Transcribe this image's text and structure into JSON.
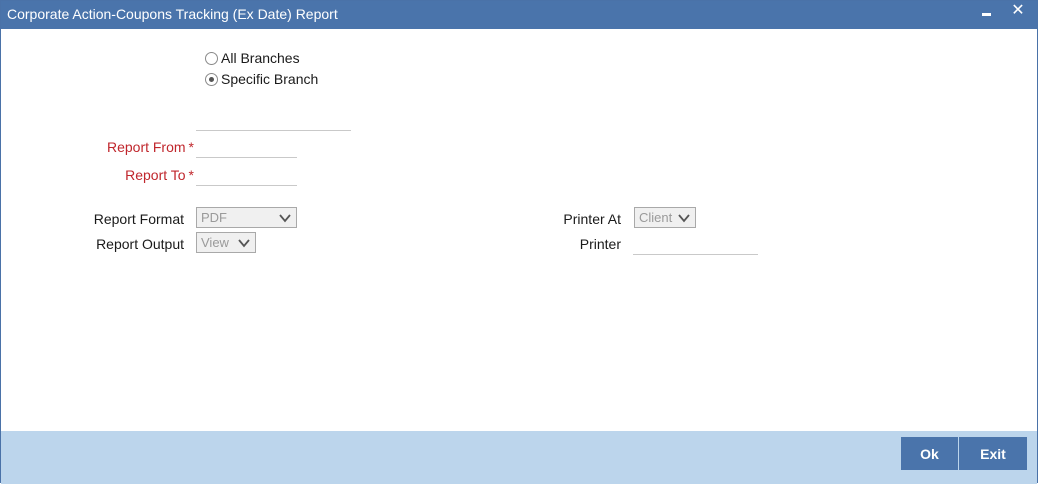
{
  "window": {
    "title": "Corporate Action-Coupons Tracking (Ex Date) Report",
    "minimize_icon": "minimize-icon",
    "close_glyph": "✕"
  },
  "branch_options": [
    {
      "label": "All Branches",
      "checked": false
    },
    {
      "label": "Specific Branch",
      "checked": true
    }
  ],
  "branch_code": {
    "value": "",
    "placeholder": ""
  },
  "report_from": {
    "label": "Report From",
    "required_marker": "*",
    "value": ""
  },
  "report_to": {
    "label": "Report To",
    "required_marker": "*",
    "value": ""
  },
  "report_format": {
    "label": "Report Format",
    "selected": "PDF"
  },
  "report_output": {
    "label": "Report Output",
    "selected": "View"
  },
  "printer_at": {
    "label": "Printer At",
    "selected": "Client"
  },
  "printer": {
    "label": "Printer",
    "value": ""
  },
  "footer": {
    "ok_label": "Ok",
    "exit_label": "Exit"
  },
  "colors": {
    "titlebar": "#4a74ab",
    "footer": "#bcd5ec",
    "button": "#4a74ab",
    "required_label": "#c0262c"
  }
}
